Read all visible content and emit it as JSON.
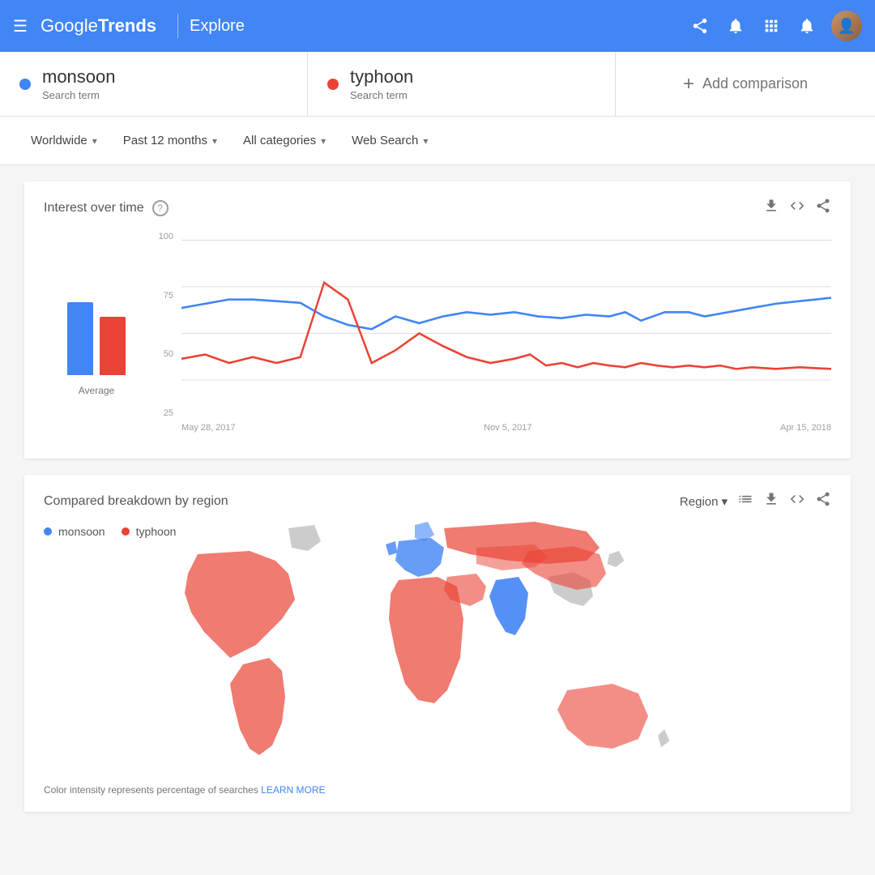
{
  "header": {
    "menu_icon": "☰",
    "logo_google": "Google",
    "logo_trends": "Trends",
    "explore_label": "Explore",
    "share_icon": "share",
    "notification_icon": "notification",
    "apps_icon": "apps",
    "alert_icon": "alert"
  },
  "search_terms": [
    {
      "id": "monsoon",
      "name": "monsoon",
      "type": "Search term",
      "color": "#4285f4"
    },
    {
      "id": "typhoon",
      "name": "typhoon",
      "type": "Search term",
      "color": "#ea4335"
    }
  ],
  "add_comparison": {
    "label": "Add comparison",
    "icon": "+"
  },
  "filters": {
    "location": {
      "label": "Worldwide",
      "icon": "▾"
    },
    "time": {
      "label": "Past 12 months",
      "icon": "▾"
    },
    "category": {
      "label": "All categories",
      "icon": "▾"
    },
    "search_type": {
      "label": "Web Search",
      "icon": "▾"
    }
  },
  "interest_over_time": {
    "title": "Interest over time",
    "help": "?",
    "y_labels": [
      "100",
      "75",
      "50",
      "25"
    ],
    "x_labels": [
      "May 28, 2017",
      "Nov 5, 2017",
      "Apr 15, 2018"
    ],
    "legend_label": "Average",
    "download_icon": "⬇",
    "embed_icon": "<>",
    "share_icon": "share",
    "bar_monsoon_height": 90,
    "bar_typhoon_height": 72,
    "monsoon_color": "#4285f4",
    "typhoon_color": "#ea4335"
  },
  "region_section": {
    "title": "Compared breakdown by region",
    "region_label": "Region",
    "region_icon": "▾",
    "list_icon": "≡",
    "download_icon": "⬇",
    "embed_icon": "<>",
    "share_icon": "share",
    "monsoon_label": "monsoon",
    "typhoon_label": "typhoon",
    "monsoon_color": "#4285f4",
    "typhoon_color": "#ea4335",
    "color_note": "Color intensity represents percentage of searches",
    "learn_more_label": "LEARN MORE"
  }
}
